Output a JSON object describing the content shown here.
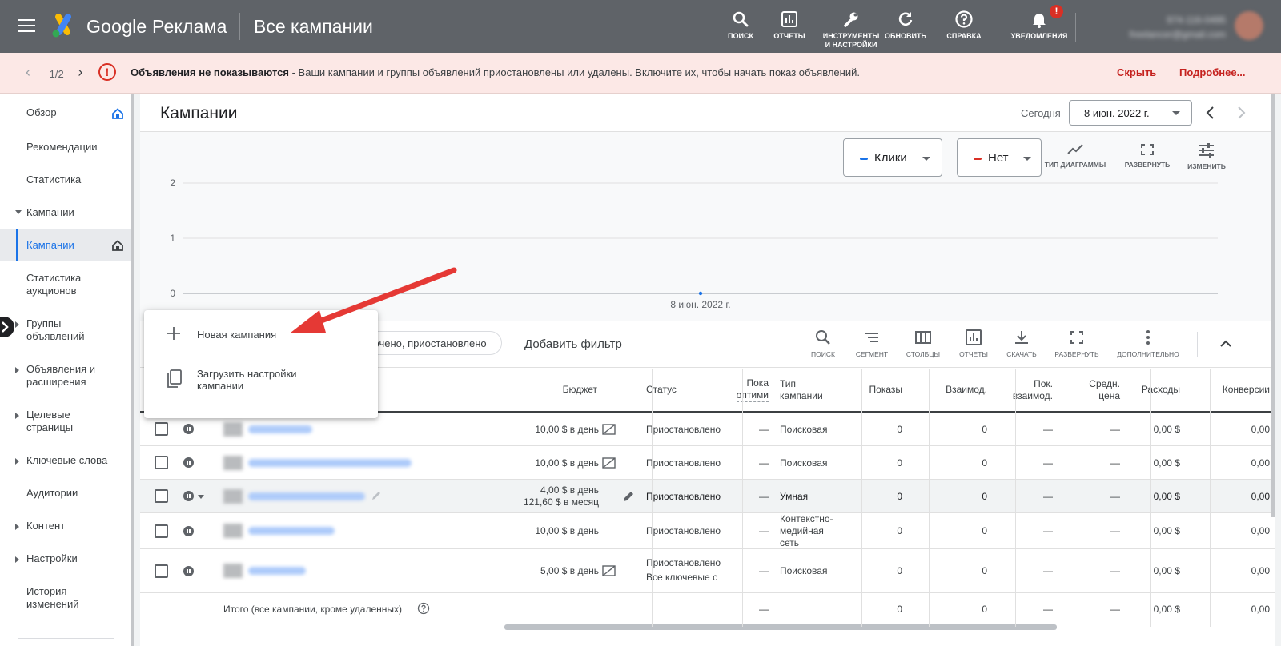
{
  "topbar": {
    "brand": "Google Реклама",
    "page_name": "Все кампании",
    "tools": [
      {
        "label": "ПОИСК",
        "icon": "search-icon"
      },
      {
        "label": "ОТЧЕТЫ",
        "icon": "reports-icon"
      },
      {
        "label": "ИНСТРУМЕНТЫ И НАСТРОЙКИ",
        "icon": "wrench-icon"
      },
      {
        "label": "ОБНОВИТЬ",
        "icon": "refresh-icon"
      },
      {
        "label": "СПРАВКА",
        "icon": "help-icon"
      },
      {
        "label": "УВЕДОМЛЕНИЯ",
        "icon": "bell-icon"
      }
    ],
    "notifications_badge": "!",
    "account_id": "974-116-0495",
    "account_email": "freelancer@gmail.com"
  },
  "alert": {
    "pager": "1/2",
    "title": "Объявления не показываются",
    "message": " - Ваши кампании и группы объявлений приостановлены или удалены. Включите их, чтобы начать показ объявлений.",
    "hide_label": "Скрыть",
    "more_label": "Подробнее..."
  },
  "sidebar": {
    "items": [
      {
        "label": "Обзор"
      },
      {
        "label": "Рекомендации"
      },
      {
        "label": "Статистика"
      },
      {
        "label": "Кампании"
      },
      {
        "label": "Кампании"
      },
      {
        "label": "Статистика аукционов"
      },
      {
        "label": "Группы объявлений"
      },
      {
        "label": "Объявления и расширения"
      },
      {
        "label": "Целевые страницы"
      },
      {
        "label": "Ключевые слова"
      },
      {
        "label": "Аудитории"
      },
      {
        "label": "Контент"
      },
      {
        "label": "Настройки"
      },
      {
        "label": "История изменений"
      }
    ]
  },
  "main": {
    "title": "Кампании",
    "today_label": "Сегодня",
    "date_value": "8 июн. 2022 г."
  },
  "chart_data": {
    "type": "line",
    "x": [
      "8 июн. 2022 г."
    ],
    "series": [
      {
        "name": "Клики",
        "values": [
          0
        ]
      }
    ],
    "ylim": [
      0,
      2
    ],
    "y_ticks": [
      "2",
      "1",
      "0"
    ],
    "metric_1": "Клики",
    "metric_1_color": "#1a73e8",
    "metric_2": "Нет",
    "metric_2_color": "#d93025",
    "tools": [
      "ТИП ДИАГРАММЫ",
      "РАЗВЕРНУТЬ",
      "ИЗМЕНИТЬ"
    ],
    "grid": true
  },
  "filter_bar": {
    "chip_text": "ючено, приостановлено",
    "add_filter": "Добавить фильтр",
    "tools": [
      "ПОИСК",
      "СЕГМЕНТ",
      "СТОЛБЦЫ",
      "ОТЧЕТЫ",
      "СКАЧАТЬ",
      "РАЗВЕРНУТЬ",
      "ДОПОЛНИТЕЛЬНО"
    ]
  },
  "table": {
    "headers": {
      "budget": "Бюджет",
      "status": "Статус",
      "opt_1": "Пока",
      "opt_2": "оптими",
      "type_1": "Тип",
      "type_2": "кампании",
      "impr": "Показы",
      "inter": "Взаимод.",
      "inter_rate_1": "Пок.",
      "inter_rate_2": "взаимод.",
      "avg_cost_1": "Средн.",
      "avg_cost_2": "цена",
      "cost": "Расходы",
      "conv": "Конверсии"
    },
    "rows": [
      {
        "budget": "10,00 $ в день",
        "status": "Приостановлено",
        "opt": "—",
        "type": "Поисковая",
        "impr": "0",
        "inter": "0",
        "rate": "—",
        "avg": "—",
        "cost": "0,00 $",
        "conv": "0,00"
      },
      {
        "budget": "10,00 $ в день",
        "status": "Приостановлено",
        "opt": "—",
        "type": "Поисковая",
        "impr": "0",
        "inter": "0",
        "rate": "—",
        "avg": "—",
        "cost": "0,00 $",
        "conv": "0,00"
      },
      {
        "budget": "4,00 $ в день",
        "budget_2": "121,60 $ в месяц",
        "status": "Приостановлено",
        "opt": "—",
        "type": "Умная",
        "impr": "0",
        "inter": "0",
        "rate": "—",
        "avg": "—",
        "cost": "0,00 $",
        "conv": "0,00"
      },
      {
        "budget": "10,00 $ в день",
        "status": "Приостановлено",
        "opt": "—",
        "type_1": "Контекстно-",
        "type_2": "медийная",
        "type_3": "сеть",
        "impr": "0",
        "inter": "0",
        "rate": "—",
        "avg": "—",
        "cost": "0,00 $",
        "conv": "0,00"
      },
      {
        "budget": "5,00 $ в день",
        "status": "Приостановлено",
        "status_2": "Все ключевые с",
        "opt": "—",
        "type": "Поисковая",
        "impr": "0",
        "inter": "0",
        "rate": "—",
        "avg": "—",
        "cost": "0,00 $",
        "conv": "0,00"
      }
    ],
    "total": {
      "label": "Итого (все кампании, кроме удаленных)",
      "opt": "—",
      "impr": "0",
      "inter": "0",
      "rate": "—",
      "avg": "—",
      "cost": "0,00 $",
      "conv": "0,00"
    }
  },
  "popup": {
    "new_campaign": "Новая кампания",
    "upload_1": "Загрузить настройки",
    "upload_2": "кампании"
  }
}
